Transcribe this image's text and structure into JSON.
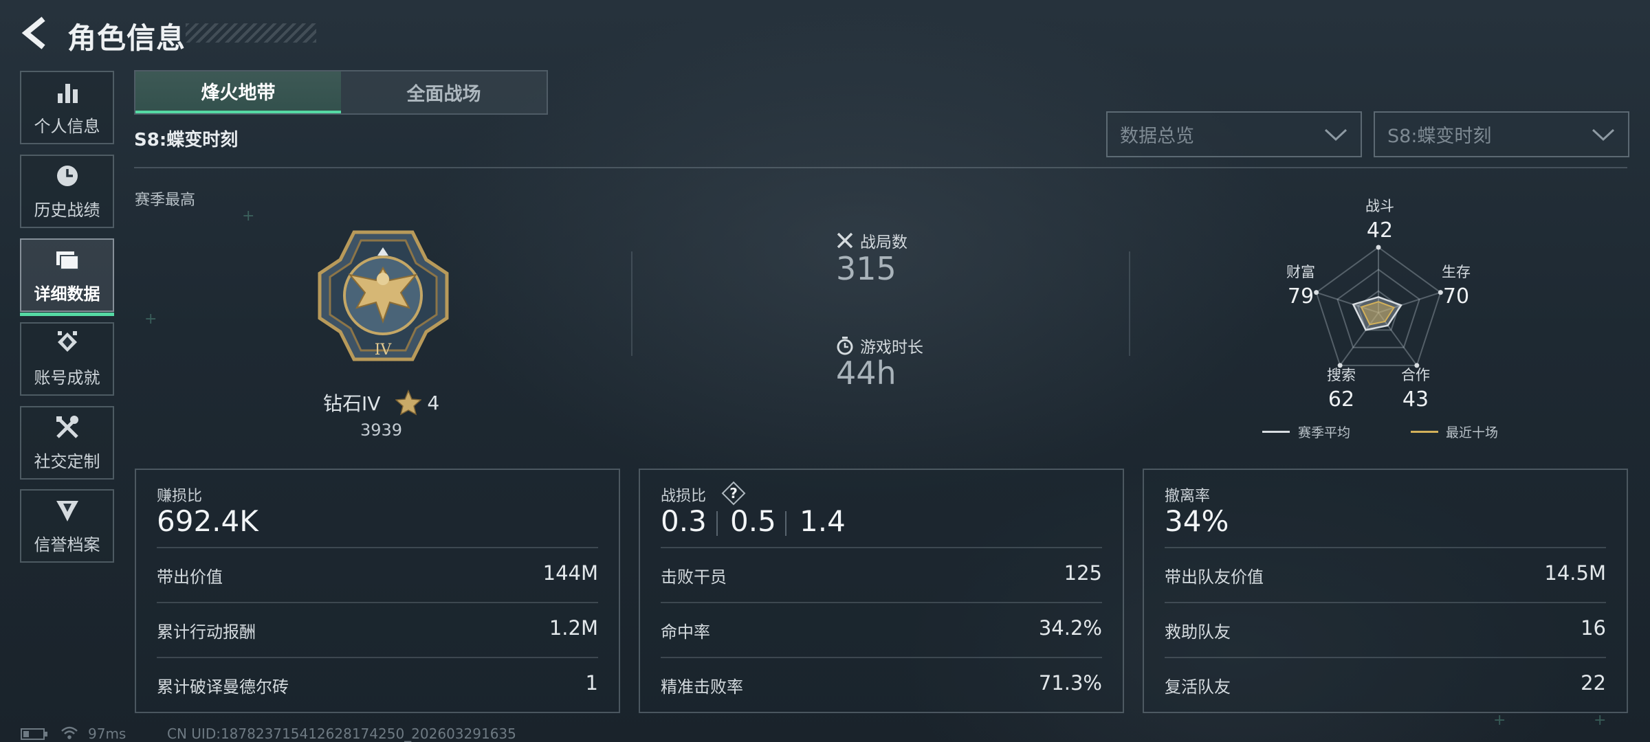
{
  "header": {
    "title": "角色信息"
  },
  "sidebar": {
    "items": [
      {
        "label": "个人信息",
        "icon": "bar-chart-icon"
      },
      {
        "label": "历史战绩",
        "icon": "history-clock-icon"
      },
      {
        "label": "详细数据",
        "icon": "folder-icon",
        "active": true
      },
      {
        "label": "账号成就",
        "icon": "achievement-icon"
      },
      {
        "label": "社交定制",
        "icon": "tools-icon"
      },
      {
        "label": "信誉档案",
        "icon": "shield-emblem-icon"
      }
    ]
  },
  "tabs": [
    {
      "label": "烽火地带",
      "active": true
    },
    {
      "label": "全面战场",
      "active": false
    }
  ],
  "season": {
    "title": "S8:蝶变时刻",
    "best_label": "赛季最高"
  },
  "filters": {
    "data_filter": "数据总览",
    "season_filter": "S8:蝶变时刻"
  },
  "rank": {
    "name": "钻石IV",
    "stars": "4",
    "score": "3939",
    "badge_numeral": "IV"
  },
  "matches": {
    "label": "战局数",
    "value": "315"
  },
  "playtime": {
    "label": "游戏时长",
    "value": "44h"
  },
  "radar": {
    "axes": [
      {
        "label": "战斗",
        "value": "42"
      },
      {
        "label": "生存",
        "value": "70"
      },
      {
        "label": "合作",
        "value": "43"
      },
      {
        "label": "搜索",
        "value": "62"
      },
      {
        "label": "财富",
        "value": "79"
      }
    ],
    "legend": {
      "season_avg": "赛季平均",
      "recent_ten": "最近十场"
    },
    "colors": {
      "season_avg": "#d9dee2",
      "recent_ten": "#d3b15a"
    }
  },
  "cards": {
    "profit": {
      "title": "赚损比",
      "value": "692.4K",
      "rows": [
        {
          "label": "带出价值",
          "value": "144M"
        },
        {
          "label": "累计行动报酬",
          "value": "1.2M"
        },
        {
          "label": "累计破译曼德尔砖",
          "value": "1"
        }
      ]
    },
    "kd": {
      "title": "战损比",
      "values": [
        "0.3",
        "0.5",
        "1.4"
      ],
      "rows": [
        {
          "label": "击败干员",
          "value": "125"
        },
        {
          "label": "命中率",
          "value": "34.2%"
        },
        {
          "label": "精准击败率",
          "value": "71.3%"
        }
      ]
    },
    "extract": {
      "title": "撤离率",
      "value": "34%",
      "rows": [
        {
          "label": "带出队友价值",
          "value": "14.5M"
        },
        {
          "label": "救助队友",
          "value": "16"
        },
        {
          "label": "复活队友",
          "value": "22"
        }
      ]
    }
  },
  "footer": {
    "ping": "97ms",
    "uid": "CN UID:187823715412628174250_202603291635"
  },
  "accent_color": "#55d9a4"
}
